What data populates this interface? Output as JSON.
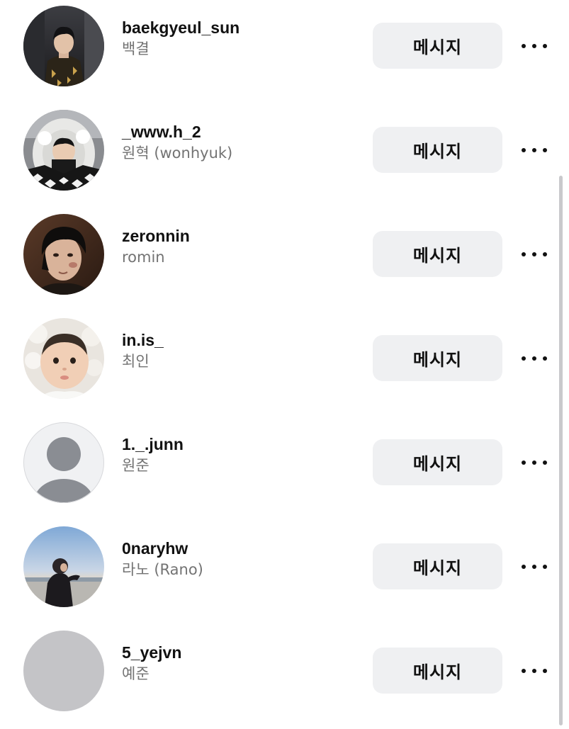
{
  "follower_list": {
    "message_label": "메시지",
    "items": [
      {
        "username": "baekgyeul_sun",
        "full_name": "백결",
        "avatar": "photo-man-dark-jacket"
      },
      {
        "username": "_www.h_2",
        "full_name": "원혁 (wonhyuk)",
        "avatar": "photo-hooded-fleece"
      },
      {
        "username": "zeronnin",
        "full_name": "romin",
        "avatar": "photo-man-dark-hair"
      },
      {
        "username": "in.is_",
        "full_name": "최인",
        "avatar": "photo-baby"
      },
      {
        "username": "1._.junn",
        "full_name": "원준",
        "avatar": "default-avatar-icon"
      },
      {
        "username": "0naryhw",
        "full_name": "라노 (Rano)",
        "avatar": "photo-beach-silhouette"
      },
      {
        "username": "5_yejvn",
        "full_name": "예준",
        "avatar": "blank-gray-avatar"
      }
    ]
  },
  "colors": {
    "button_bg": "#eff0f2",
    "secondary_text": "#737373",
    "primary_text": "#111111"
  }
}
